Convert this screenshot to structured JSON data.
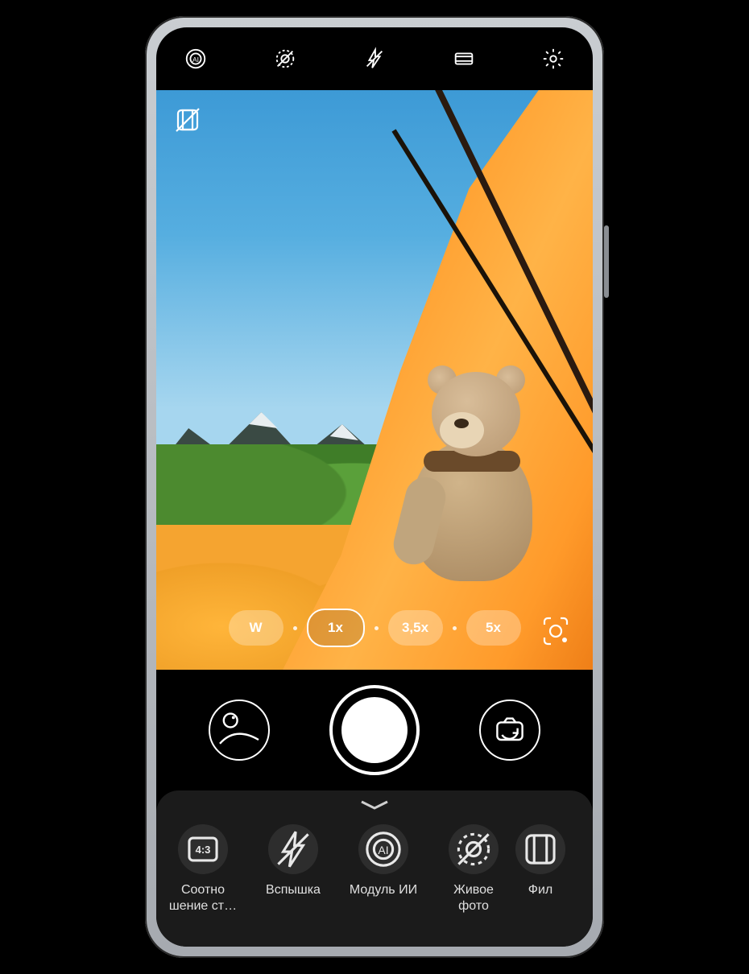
{
  "topbar_icons": [
    "ai",
    "live-photo-off",
    "flash-off",
    "aspect",
    "settings"
  ],
  "overlay_icon": "filter-off",
  "zoom": {
    "options": [
      "W",
      "1x",
      "3,5x",
      "5x"
    ],
    "selected": "1x"
  },
  "lens_button": "google-lens",
  "capture": {
    "gallery": "gallery",
    "shutter": "shutter",
    "switch": "switch-camera"
  },
  "drawer": {
    "tools": [
      {
        "icon": "aspect",
        "badge": "4:3",
        "label": "Соотно шение ст…"
      },
      {
        "icon": "flash-off",
        "label": "Вспышка"
      },
      {
        "icon": "ai",
        "label": "Модуль ИИ"
      },
      {
        "icon": "live-photo-off",
        "label": "Живое фото"
      },
      {
        "icon": "filter",
        "label": "Фил"
      }
    ]
  }
}
